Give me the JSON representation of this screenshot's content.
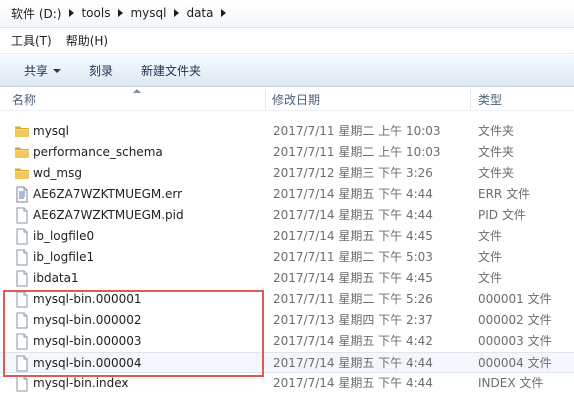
{
  "breadcrumb": [
    "软件 (D:)",
    "tools",
    "mysql",
    "data"
  ],
  "menu": [
    "工具(T)",
    "帮助(H)"
  ],
  "toolbar": {
    "share_label": "共享",
    "burn_label": "刻录",
    "new_folder_label": "新建文件夹"
  },
  "columns": {
    "name": "名称",
    "date": "修改日期",
    "type": "类型"
  },
  "files": [
    {
      "name": "mysql",
      "date": "2017/7/11 星期二 上午 10:03",
      "type": "文件夹",
      "icon": "folder-icon"
    },
    {
      "name": "performance_schema",
      "date": "2017/7/11 星期二 上午 10:03",
      "type": "文件夹",
      "icon": "folder-icon"
    },
    {
      "name": "wd_msg",
      "date": "2017/7/12 星期三 下午 3:26",
      "type": "文件夹",
      "icon": "folder-icon"
    },
    {
      "name": "AE6ZA7WZKTMUEGM.err",
      "date": "2017/7/14 星期五 下午 4:44",
      "type": "ERR 文件",
      "icon": "text-file-icon"
    },
    {
      "name": "AE6ZA7WZKTMUEGM.pid",
      "date": "2017/7/14 星期五 下午 4:44",
      "type": "PID 文件",
      "icon": "file-icon"
    },
    {
      "name": "ib_logfile0",
      "date": "2017/7/14 星期五 下午 4:45",
      "type": "文件",
      "icon": "file-icon"
    },
    {
      "name": "ib_logfile1",
      "date": "2017/7/11 星期二 下午 5:03",
      "type": "文件",
      "icon": "file-icon"
    },
    {
      "name": "ibdata1",
      "date": "2017/7/14 星期五 下午 4:45",
      "type": "文件",
      "icon": "file-icon"
    },
    {
      "name": "mysql-bin.000001",
      "date": "2017/7/11 星期二 下午 5:26",
      "type": "000001 文件",
      "icon": "file-icon"
    },
    {
      "name": "mysql-bin.000002",
      "date": "2017/7/13 星期四 下午 2:37",
      "type": "000002 文件",
      "icon": "file-icon"
    },
    {
      "name": "mysql-bin.000003",
      "date": "2017/7/14 星期五 下午 4:42",
      "type": "000003 文件",
      "icon": "file-icon"
    },
    {
      "name": "mysql-bin.000004",
      "date": "2017/7/14 星期五 下午 4:44",
      "type": "000004 文件",
      "icon": "file-icon"
    },
    {
      "name": "mysql-bin.index",
      "date": "2017/7/14 星期五 下午 4:44",
      "type": "INDEX 文件",
      "icon": "file-icon"
    }
  ],
  "hovered_index": 11,
  "colors": {
    "folder": "#e8b73a",
    "highlight_box": "#e05a55"
  }
}
